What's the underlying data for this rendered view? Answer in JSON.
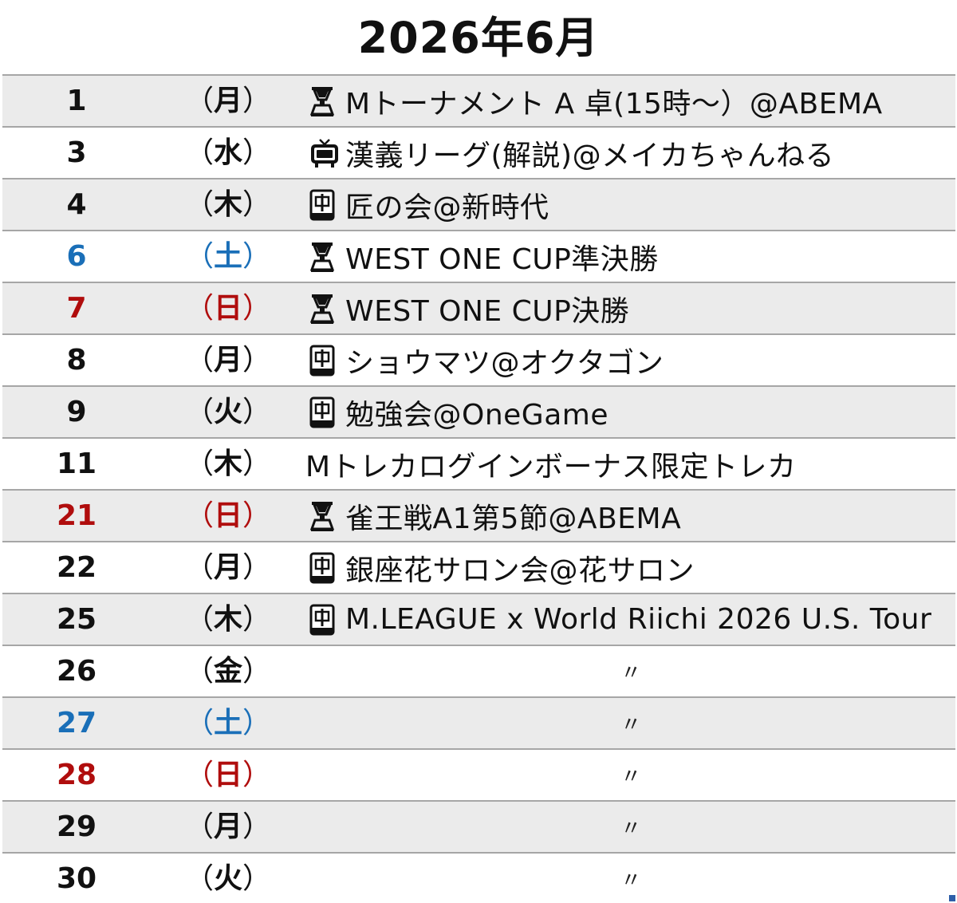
{
  "title": "2026年6月",
  "colors": {
    "row_shade": "#ebebeb",
    "row_plain": "#ffffff",
    "grid_line": "#a6a6a6",
    "saturday": "#1a6fb8",
    "sunday": "#b00d0d",
    "weekday": "#111111"
  },
  "rows": [
    {
      "day": "1",
      "weekday": "月",
      "color": "weekday",
      "icon": "trophy-icon",
      "event": "Mトーナメント A 卓(15時〜）@ABEMA"
    },
    {
      "day": "3",
      "weekday": "水",
      "color": "weekday",
      "icon": "tv-icon",
      "event": "漢義リーグ(解説)@メイカちゃんねる"
    },
    {
      "day": "4",
      "weekday": "木",
      "color": "weekday",
      "icon": "mahjong-tile-icon",
      "event": "匠の会@新時代"
    },
    {
      "day": "6",
      "weekday": "土",
      "color": "saturday",
      "icon": "trophy-icon",
      "event": "WEST ONE CUP準決勝"
    },
    {
      "day": "7",
      "weekday": "日",
      "color": "sunday",
      "icon": "trophy-icon",
      "event": "WEST ONE CUP決勝"
    },
    {
      "day": "8",
      "weekday": "月",
      "color": "weekday",
      "icon": "mahjong-tile-icon",
      "event": "ショウマツ@オクタゴン"
    },
    {
      "day": "9",
      "weekday": "火",
      "color": "weekday",
      "icon": "mahjong-tile-icon",
      "event": "勉強会@OneGame"
    },
    {
      "day": "11",
      "weekday": "木",
      "color": "weekday",
      "icon": "",
      "event": "Mトレカログインボーナス限定トレカ"
    },
    {
      "day": "21",
      "weekday": "日",
      "color": "sunday",
      "icon": "trophy-icon",
      "event": "雀王戦A1第5節@ABEMA"
    },
    {
      "day": "22",
      "weekday": "月",
      "color": "weekday",
      "icon": "mahjong-tile-icon",
      "event": "銀座花サロン会@花サロン"
    },
    {
      "day": "25",
      "weekday": "木",
      "color": "weekday",
      "icon": "mahjong-tile-icon",
      "event": "M.LEAGUE x World Riichi 2026 U.S. Tour"
    },
    {
      "day": "26",
      "weekday": "金",
      "color": "weekday",
      "icon": "",
      "event": "〃"
    },
    {
      "day": "27",
      "weekday": "土",
      "color": "saturday",
      "icon": "",
      "event": "〃"
    },
    {
      "day": "28",
      "weekday": "日",
      "color": "sunday",
      "icon": "",
      "event": "〃"
    },
    {
      "day": "29",
      "weekday": "月",
      "color": "weekday",
      "icon": "",
      "event": "〃"
    },
    {
      "day": "30",
      "weekday": "火",
      "color": "weekday",
      "icon": "",
      "event": "〃"
    }
  ]
}
